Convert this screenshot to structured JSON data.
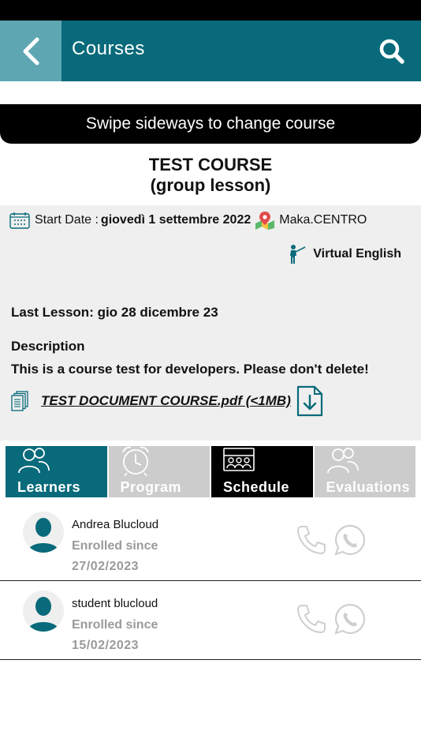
{
  "header": {
    "title": "Courses"
  },
  "banner": {
    "text": "Swipe sideways to change course"
  },
  "course": {
    "name": "TEST COURSE",
    "type": "(group lesson)",
    "start_label": "Start Date :",
    "start_value": "giovedì 1 settembre 2022",
    "location": "Maka.CENTRO",
    "teacher": "Virtual English",
    "last_lesson": "Last Lesson: gio 28 dicembre 23",
    "description_label": "Description",
    "description": "This is a course test for developers. Please don't delete!",
    "document": "TEST DOCUMENT COURSE.pdf (<1MB) "
  },
  "tabs": [
    {
      "label": "Learners",
      "icon": "users-icon"
    },
    {
      "label": "Program",
      "icon": "alarm-clock-icon"
    },
    {
      "label": "Schedule",
      "icon": "classroom-icon"
    },
    {
      "label": "Evaluations",
      "icon": "users-icon"
    }
  ],
  "learners": [
    {
      "name": "Andrea Blucloud",
      "enrolled_label": "Enrolled since",
      "enrolled_date": "27/02/2023"
    },
    {
      "name": "student blucloud",
      "enrolled_label": "Enrolled since",
      "enrolled_date": "15/02/2023"
    }
  ],
  "colors": {
    "primary": "#086a7a",
    "back_button": "#5ea7b2",
    "panel": "#efefef",
    "inactive_tab": "#cccccc"
  }
}
